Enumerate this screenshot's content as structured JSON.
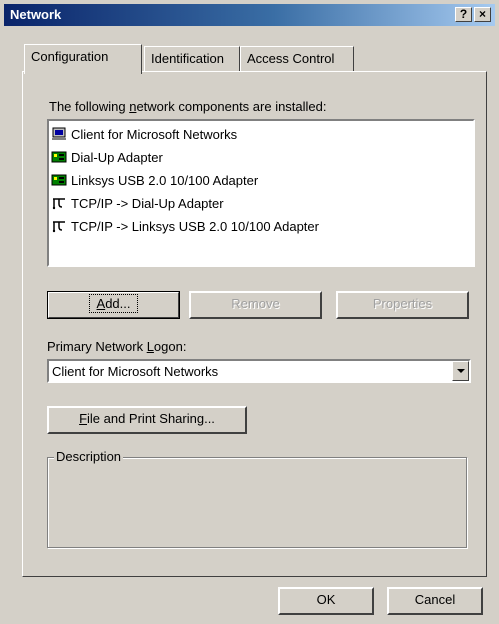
{
  "window": {
    "title": "Network",
    "help_glyph": "?",
    "close_glyph": "×"
  },
  "tabs": [
    {
      "label": "Configuration",
      "active": true
    },
    {
      "label": "Identification",
      "active": false
    },
    {
      "label": "Access Control",
      "active": false
    }
  ],
  "config": {
    "installed_label_pre": "The following ",
    "installed_label_accel": "n",
    "installed_label_post": "etwork components are installed:",
    "components": [
      {
        "icon": "client-icon",
        "label": "Client for Microsoft Networks"
      },
      {
        "icon": "adapter-icon",
        "label": "Dial-Up Adapter"
      },
      {
        "icon": "adapter-icon",
        "label": "Linksys USB 2.0 10/100 Adapter"
      },
      {
        "icon": "protocol-icon",
        "label": "TCP/IP -> Dial-Up Adapter"
      },
      {
        "icon": "protocol-icon",
        "label": "TCP/IP -> Linksys USB 2.0 10/100 Adapter"
      }
    ],
    "add_accel": "A",
    "add_rest": "dd...",
    "remove_label": "Remove",
    "properties_label": "Properties",
    "logon_label_pre": "Primary Network ",
    "logon_label_accel": "L",
    "logon_label_post": "ogon:",
    "logon_value": "Client for Microsoft Networks",
    "share_accel": "F",
    "share_rest": "ile and Print Sharing...",
    "description_label": "Description"
  },
  "footer": {
    "ok_label": "OK",
    "cancel_label": "Cancel"
  }
}
